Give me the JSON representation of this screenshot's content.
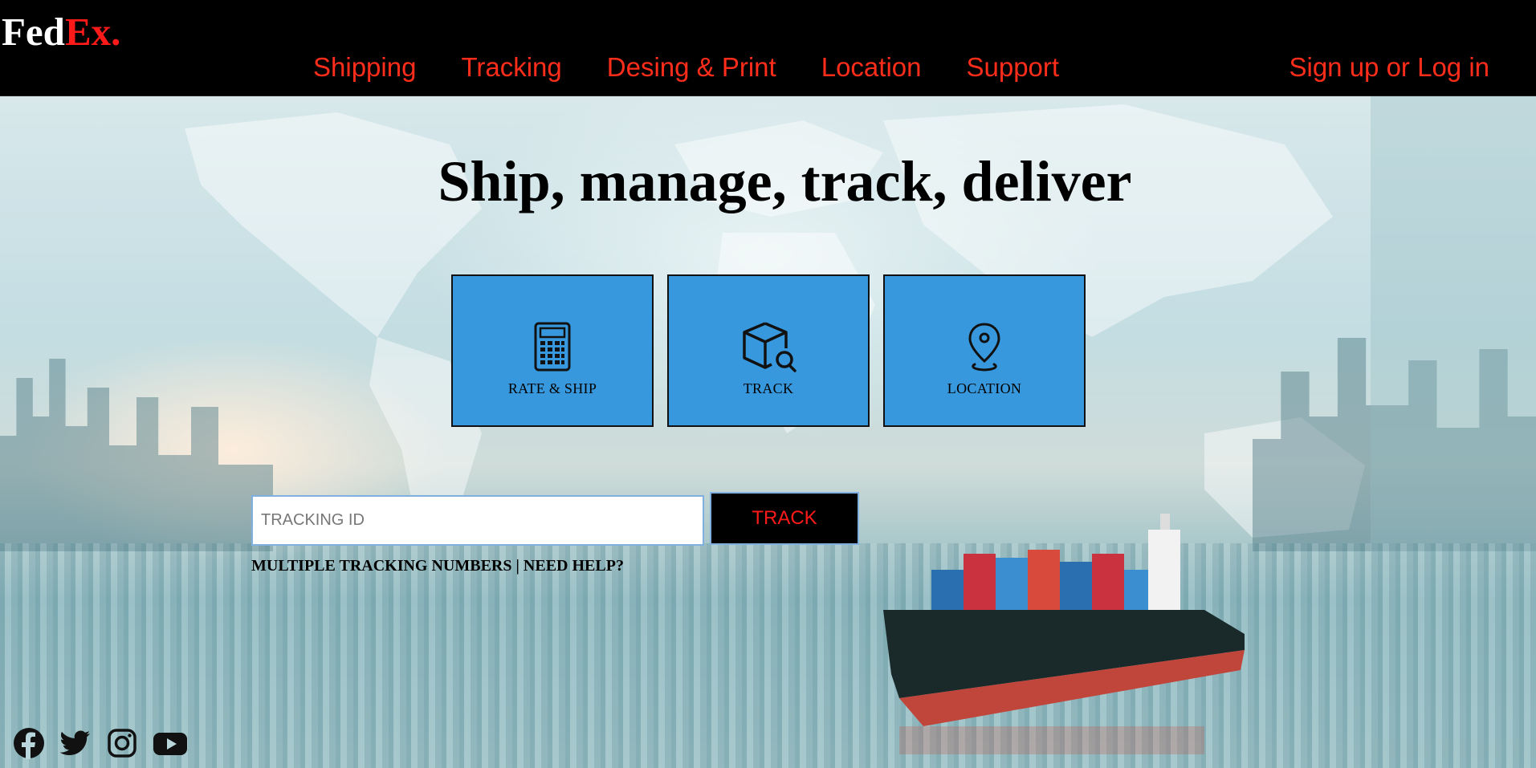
{
  "brand": {
    "fed": "Fed",
    "ex": "Ex."
  },
  "nav": {
    "items": [
      "Shipping",
      "Tracking",
      "Desing & Print",
      "Location",
      "Support"
    ],
    "signin": "Sign up or Log in"
  },
  "hero": {
    "headline": "Ship, manage, track, deliver",
    "cards": [
      {
        "label": "RATE & SHIP",
        "icon": "calculator-icon"
      },
      {
        "label": "TRACK",
        "icon": "package-search-icon"
      },
      {
        "label": "LOCATION",
        "icon": "map-pin-icon"
      }
    ]
  },
  "tracking": {
    "placeholder": "TRACKING ID",
    "button": "TRACK",
    "multiple": "MULTIPLE TRACKING NUMBERS",
    "separator": " | ",
    "help": "NEED HELP?"
  },
  "social": [
    "facebook-icon",
    "twitter-icon",
    "instagram-icon",
    "youtube-icon"
  ],
  "colors": {
    "accent": "#ff1a1a",
    "card": "#3898dd",
    "header": "#000000"
  }
}
